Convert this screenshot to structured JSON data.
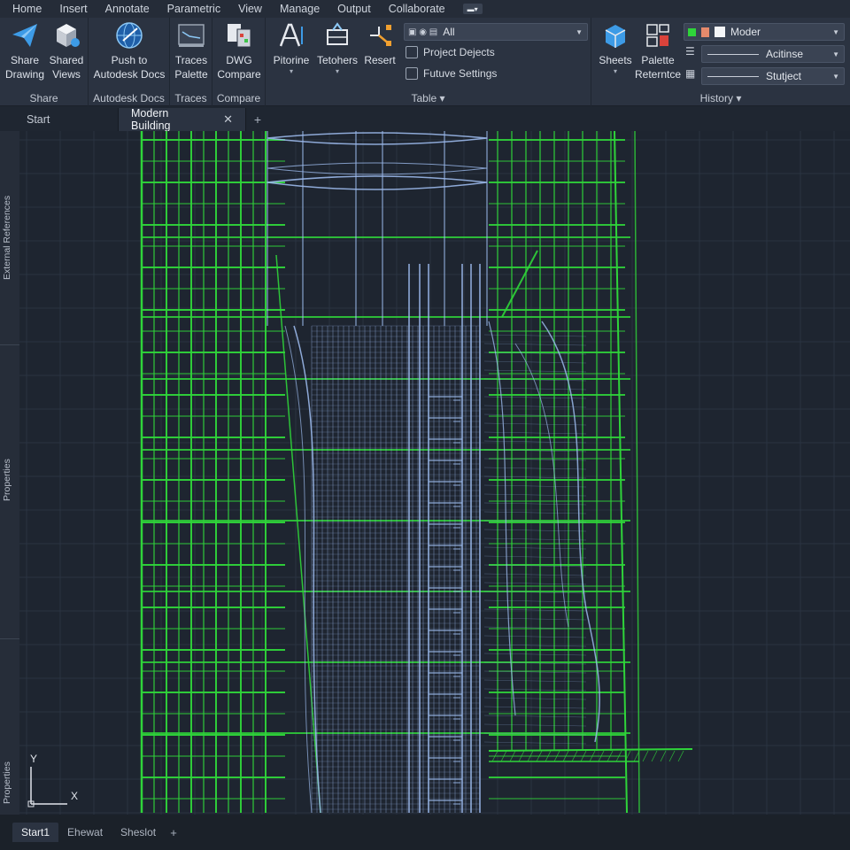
{
  "menu": [
    "Home",
    "Insert",
    "Annotate",
    "Parametric",
    "View",
    "Manage",
    "Output",
    "Collaborate"
  ],
  "ribbon": {
    "share": {
      "title": "Share",
      "share_drawing": [
        "Share",
        "Drawing"
      ],
      "shared_views": [
        "Shared",
        "Views"
      ]
    },
    "autodesk_docs": {
      "title": "Autodesk Docs",
      "push": [
        "Push to",
        "Autodesk Docs"
      ]
    },
    "traces": {
      "title": "Traces",
      "palette": [
        "Traces",
        "Palette"
      ]
    },
    "compare": {
      "title": "Compare",
      "dwg": [
        "DWG",
        "Compare"
      ]
    },
    "table": {
      "title": "Table",
      "pitorine": "Pitorine",
      "tetohers": "Tetohers",
      "resert": "Resert",
      "filter_value": "All",
      "project_dejects": "Project Dejects",
      "futuve_settings": "Futuve Settings"
    },
    "history": {
      "title": "History",
      "sheets": "Sheets",
      "palette_reference": [
        "Palette",
        "Reterntce"
      ],
      "layer_value": "Moder",
      "line1_value": "Acitinse",
      "line2_value": "Stutject"
    }
  },
  "tabs": {
    "start": "Start",
    "active": "Modern Building",
    "close_glyph": "✕",
    "add_glyph": "+"
  },
  "side_palettes": [
    "External References",
    "Properties",
    "Properties"
  ],
  "ucs": {
    "y": "Y",
    "x": "X"
  },
  "layout_tabs": [
    "Start1",
    "Ehewat",
    "Sheslot"
  ],
  "layout_add": "+",
  "colors": {
    "wire_green": "#2fd43a",
    "wire_blue": "#9ab8ea",
    "canvas_bg": "#1e2530",
    "ribbon_bg": "#2b3341",
    "accent_blue": "#3d9be6"
  },
  "icons": {
    "share_drawing": "paper-plane-icon",
    "shared_views": "cube-icon",
    "push_docs": "globe-icon",
    "traces": "traces-icon",
    "dwg_compare": "compare-icon",
    "pitorine": "text-icon",
    "tetohers": "layout-icon",
    "resert": "reset-icon",
    "sheets": "sheets-icon",
    "palette_reference": "palette-icon"
  }
}
